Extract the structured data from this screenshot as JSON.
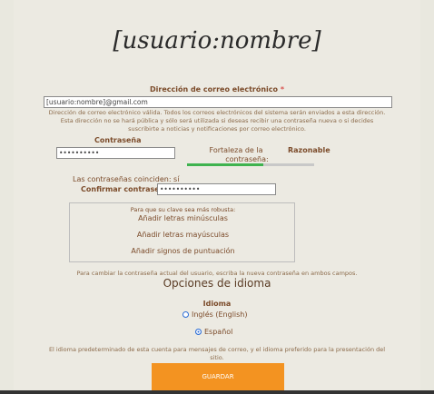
{
  "title": "[usuario:nombre]",
  "email": {
    "label": "Dirección de correo electrónico",
    "required_mark": "*",
    "value": "[usuario:nombre]@gmail.com",
    "description_line1": "Dirección de correo electrónico válida. Todos los correos electrónicos del sistema serán enviados a esta dirección.",
    "description_line2": "Esta dirección no se hará pública y sólo será utilizada si deseas recibir una contraseña nueva o si decides",
    "description_line3": "suscribirte a noticias y notificaciones por correo electrónico."
  },
  "password": {
    "label": "Contraseña",
    "value": "••••••••••",
    "strength_label": "Fortaleza de la contraseña:",
    "strength_label_line1": "Fortaleza de la",
    "strength_label_line2": "contraseña:",
    "strength_value": "Razonable",
    "strength_fraction": 0.6,
    "match_text": "Las contraseñas coinciden: sí",
    "confirm_label": "Confirmar contraseña",
    "confirm_value": "••••••••••"
  },
  "tips": {
    "heading": "Para que su clave sea más robusta:",
    "items": [
      "Añadir letras minúsculas",
      "Añadir letras mayúsculas",
      "Añadir signos de puntuación"
    ]
  },
  "change_password_note": "Para cambiar la contraseña actual del usuario, escriba la nueva contraseña en ambos campos.",
  "language": {
    "section_title": "Opciones de idioma",
    "label": "Idioma",
    "options": [
      {
        "label": "Inglés (English)",
        "selected": false
      },
      {
        "label": "Español",
        "selected": true
      }
    ],
    "description_line1": "El idioma predeterminado de esta cuenta para mensajes de correo, y el idioma preferido para la presentación del",
    "description_line2": "sitio."
  },
  "save_label": "GUARDAR",
  "colors": {
    "accent": "#f39321",
    "strength": "#3fb34f",
    "radio": "#2a6cd6",
    "label_text": "#7b4b2a"
  }
}
